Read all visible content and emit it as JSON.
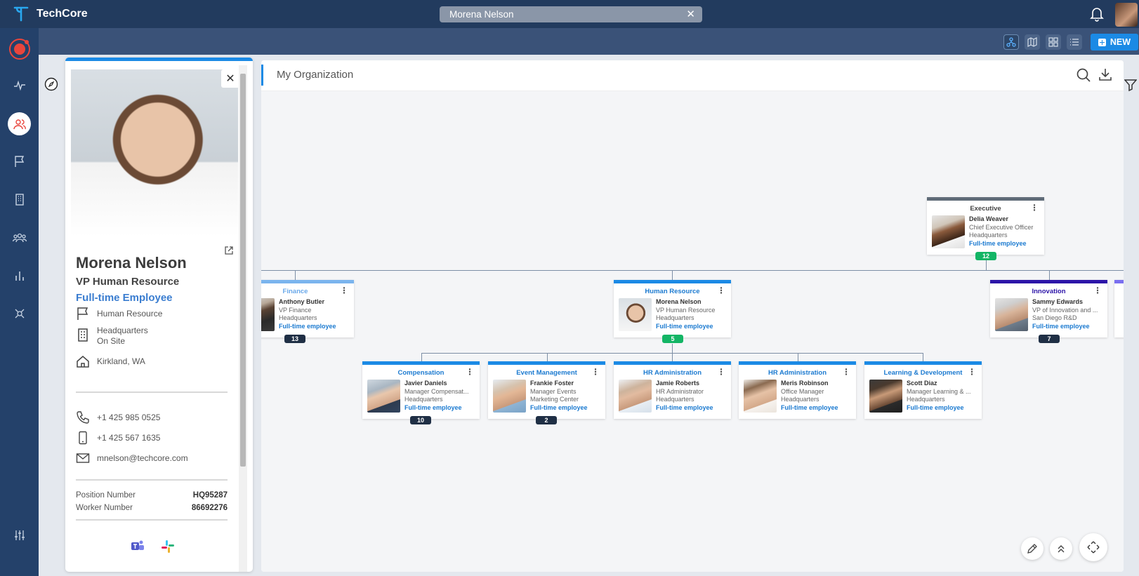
{
  "app": {
    "title": "TechCore"
  },
  "search": {
    "value": "Morena Nelson"
  },
  "toolbar": {
    "new_label": "NEW"
  },
  "org": {
    "title": "My Organization"
  },
  "profile": {
    "name": "Morena Nelson",
    "title": "VP Human Resource",
    "type": "Full-time Employee",
    "department": "Human Resource",
    "location_line1": "Headquarters",
    "location_line2": "On Site",
    "city": "Kirkland, WA",
    "phone": "+1 425 985 0525",
    "mobile": "+1 425 567 1635",
    "email": "mnelson@techcore.com",
    "position_label": "Position Number",
    "position_value": "HQ95287",
    "worker_label": "Worker Number",
    "worker_value": "86692276"
  },
  "cards": {
    "executive": {
      "dept": "Executive",
      "name": "Delia Weaver",
      "title": "Chief Executive Officer",
      "location": "Headquarters",
      "type": "Full-time employee",
      "count": "12"
    },
    "finance": {
      "dept": "Finance",
      "name": "Anthony Butler",
      "title": "VP Finance",
      "location": "Headquarters",
      "type": "Full-time employee",
      "count": "13"
    },
    "hr": {
      "dept": "Human Resource",
      "name": "Morena Nelson",
      "title": "VP Human Resource",
      "location": "Headquarters",
      "type": "Full-time employee",
      "count": "5"
    },
    "innovation": {
      "dept": "Innovation",
      "name": "Sammy Edwards",
      "title": "VP of Innovation and ...",
      "location": "San Diego R&D",
      "type": "Full-time employee",
      "count": "7"
    },
    "compensation": {
      "dept": "Compensation",
      "name": "Javier Daniels",
      "title": "Manager Compensat...",
      "location": "Headquarters",
      "type": "Full-time employee",
      "count": "10"
    },
    "events": {
      "dept": "Event Management",
      "name": "Frankie Foster",
      "title": "Manager Events",
      "location": "Marketing Center",
      "type": "Full-time employee",
      "count": "2"
    },
    "hradmin1": {
      "dept": "HR Administration",
      "name": "Jamie Roberts",
      "title": "HR Administrator",
      "location": "Headquarters",
      "type": "Full-time employee"
    },
    "hradmin2": {
      "dept": "HR Administration",
      "name": "Meris Robinson",
      "title": "Office Manager",
      "location": "Headquarters",
      "type": "Full-time employee"
    },
    "learning": {
      "dept": "Learning & Development",
      "name": "Scott Diaz",
      "title": "Manager Learning & ...",
      "location": "Headquarters",
      "type": "Full-time employee"
    }
  },
  "colors": {
    "accent": "#1b8ae5",
    "navy": "#223b5e",
    "executive_bar": "#5f6b78",
    "innovation_bar": "#2c14a8",
    "finance_bar": "#7ab4ee",
    "green": "#13b565"
  },
  "icons": [
    "techcore-logo",
    "bell-icon",
    "compass-icon",
    "org-chart-icon",
    "map-icon",
    "grid-icon",
    "list-icon",
    "plus-icon",
    "search-icon",
    "download-icon",
    "filter-icon",
    "flag-icon",
    "building-icon",
    "home-icon",
    "phone-icon",
    "mobile-icon",
    "mail-icon",
    "external-link-icon",
    "teams-icon",
    "slack-icon",
    "edit-icon",
    "collapse-icon",
    "fit-screen-icon"
  ]
}
